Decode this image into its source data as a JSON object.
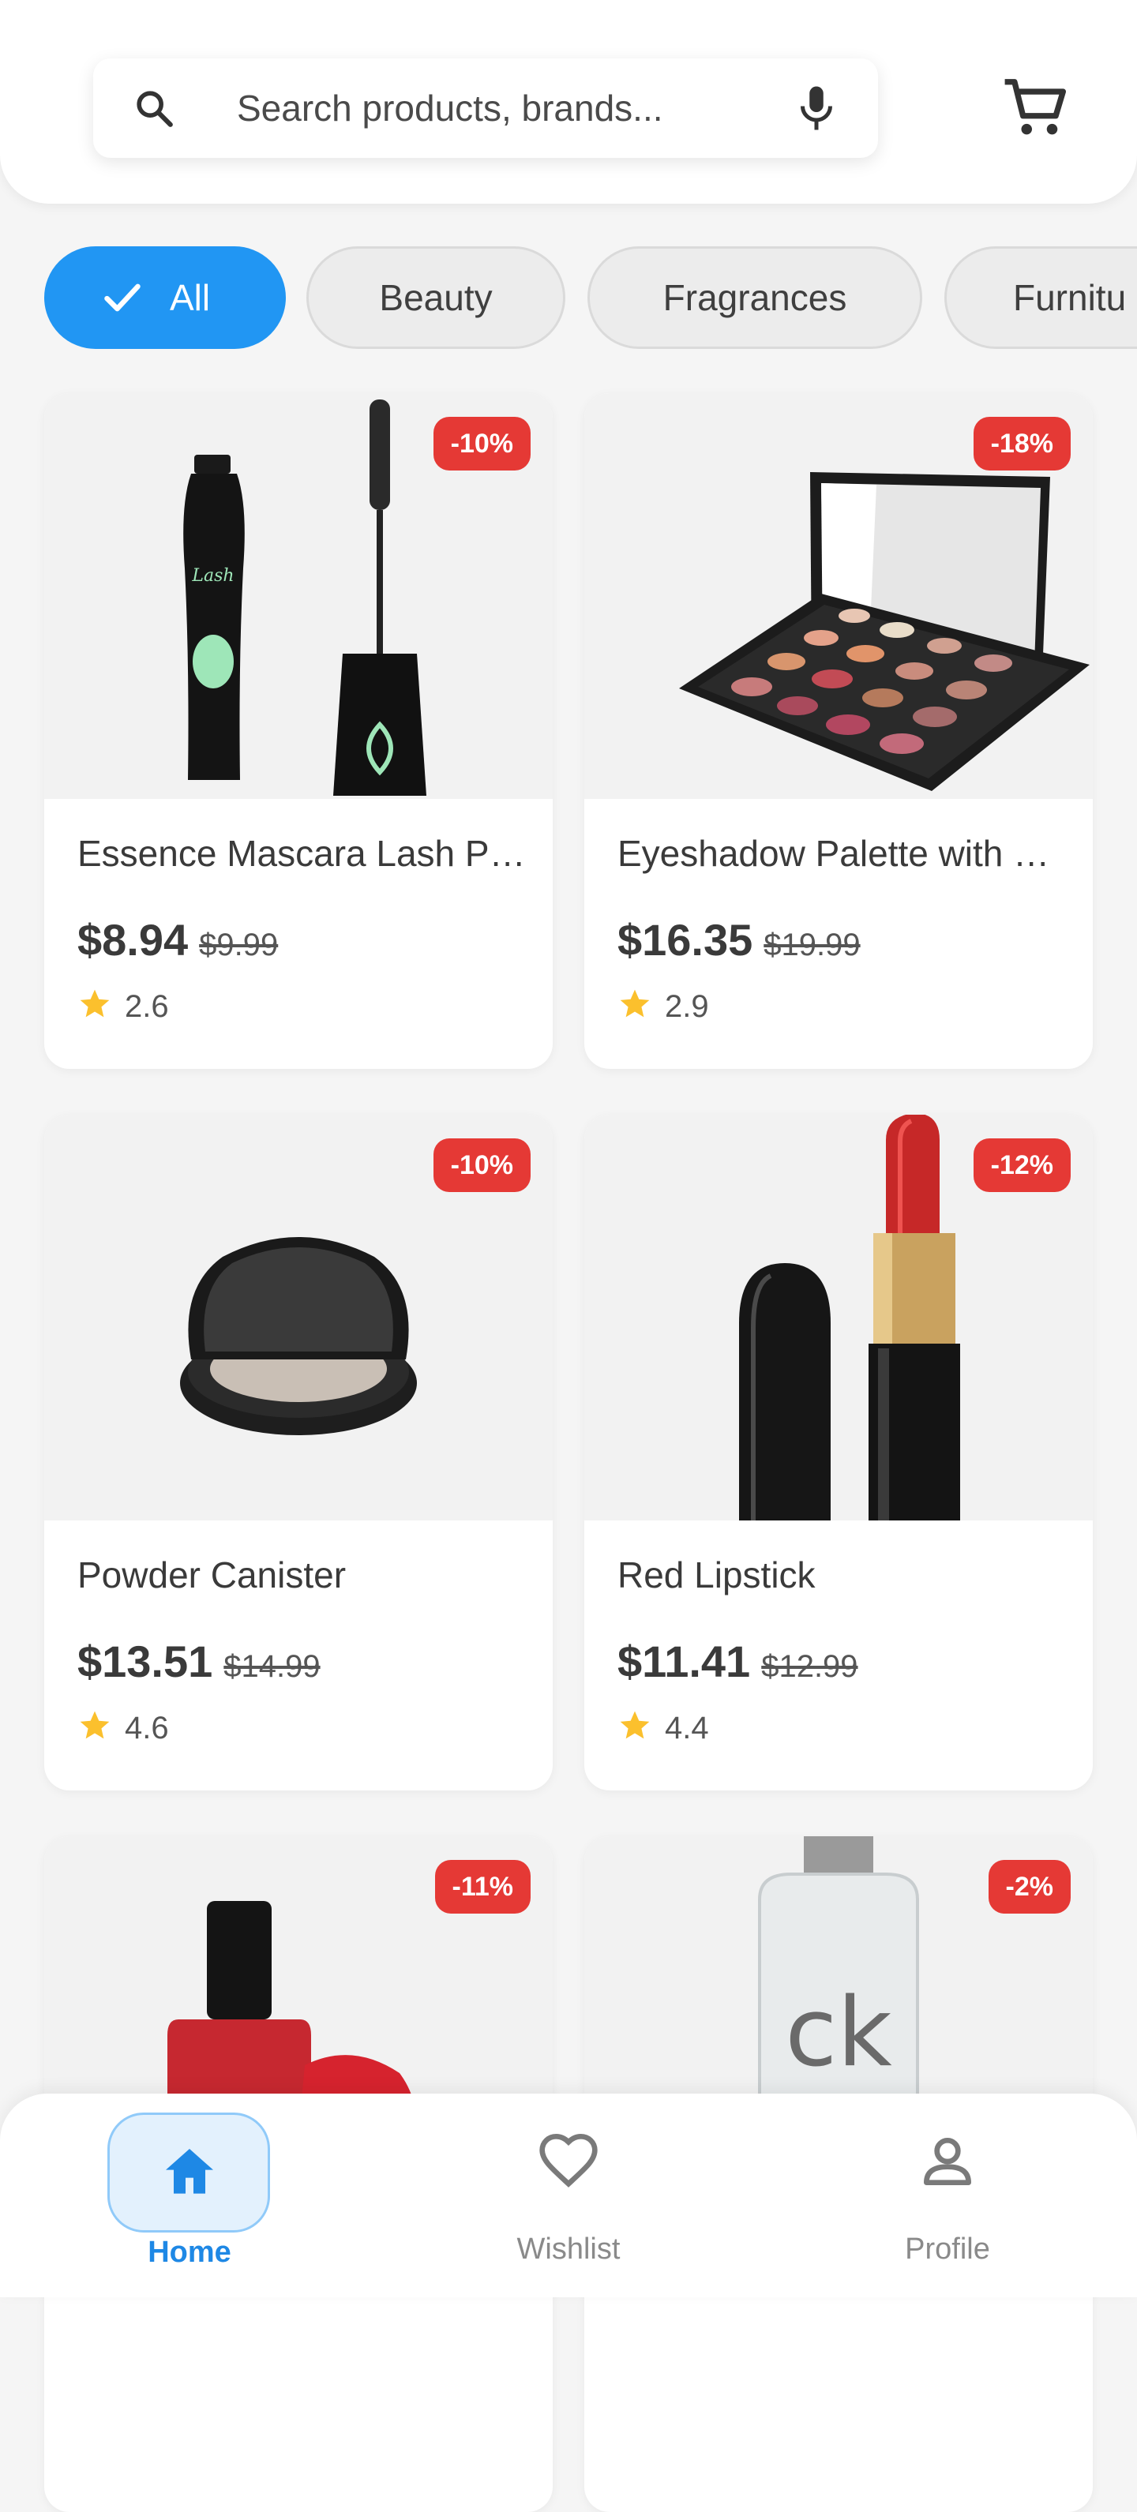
{
  "search": {
    "placeholder": "Search products, brands..."
  },
  "icons": {
    "search": "search-icon",
    "mic": "mic-icon",
    "cart": "cart-icon"
  },
  "categories": [
    {
      "label": "All",
      "selected": true
    },
    {
      "label": "Beauty",
      "selected": false
    },
    {
      "label": "Fragrances",
      "selected": false
    },
    {
      "label": "Furnitu",
      "selected": false
    }
  ],
  "products": [
    {
      "title": "Essence Mascara Lash Princess",
      "price": "$8.94",
      "old_price": "$9.99",
      "rating": "2.6",
      "discount": "-10%"
    },
    {
      "title": "Eyeshadow Palette with Mirror",
      "price": "$16.35",
      "old_price": "$19.99",
      "rating": "2.9",
      "discount": "-18%"
    },
    {
      "title": "Powder Canister",
      "price": "$13.51",
      "old_price": "$14.99",
      "rating": "4.6",
      "discount": "-10%"
    },
    {
      "title": "Red Lipstick",
      "price": "$11.41",
      "old_price": "$12.99",
      "rating": "4.4",
      "discount": "-12%"
    },
    {
      "discount": "-11%"
    },
    {
      "discount": "-2%"
    }
  ],
  "nav": [
    {
      "label": "Home",
      "active": true
    },
    {
      "label": "Wishlist",
      "active": false
    },
    {
      "label": "Profile",
      "active": false
    }
  ],
  "colors": {
    "accent": "#2196f3",
    "discount": "#e53935",
    "star": "#fbc02d"
  }
}
